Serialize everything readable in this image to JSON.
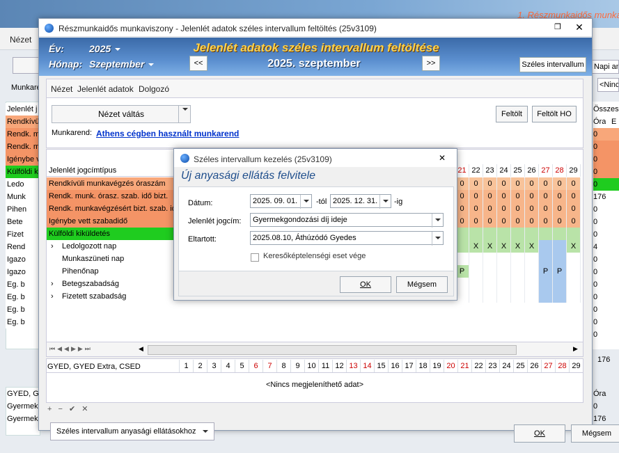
{
  "background": {
    "banner_title": "1. Részmunkaidős munkaviszony (Munkarend",
    "nezet": "Nézet",
    "munkarend": "Munkarend",
    "napi": "Napi ana",
    "nincs": "<Nincs",
    "left_rows": [
      "Jelenlét j",
      "Rendkívüli",
      "Rendk. m",
      "Rendk. m",
      "Igénybe v",
      "Külföldi k",
      "Ledo",
      "Munk",
      "Pihen",
      "Bete",
      "Fizet",
      "Rend",
      "Igazo",
      "Igazo",
      "Eg. b",
      "Eg. b",
      "Eg. b",
      "Eg. b"
    ],
    "right_header": "Összesít",
    "right_cols": [
      "Óra",
      "E"
    ],
    "right_values": [
      "0",
      "0",
      "0",
      "0",
      "0",
      "176",
      "0",
      "0",
      "0",
      "4",
      "0",
      "0",
      "0",
      "0",
      "0",
      "0",
      "0"
    ],
    "right_total": "176",
    "lower_rows": [
      "GYED, GY",
      "Gyermek",
      "Gyermek"
    ],
    "lower_right": [
      "Óra",
      "0",
      "176"
    ]
  },
  "window": {
    "title": "Részmunkaidős munkaviszony - Jelenlét adatok széles intervallum feltöltés (25v3109)",
    "ev_label": "Év:",
    "ev_value": "2025",
    "honap_label": "Hónap:",
    "honap_value": "Szeptember",
    "header_title": "Jelenlét adatok széles intervallum feltöltése",
    "header_date": "2025. szeptember",
    "prev": "<<",
    "next": ">>",
    "szeles_btn": "Széles intervallum",
    "menu": [
      "Nézet",
      "Jelenlét adatok",
      "Dolgozó"
    ],
    "nezet_valtas": "Nézet váltás",
    "feltolt": "Feltölt",
    "feltolt_ho": "Feltölt HO",
    "munkarend_label": "Munkarend:",
    "munkarend_link": "Athens cégben használt munkarend",
    "grid_header": "Jelenlét jogcímtípus",
    "grid_rows": [
      {
        "label": "Rendkívüli munkavégzés óraszám",
        "style": "orange",
        "indent": 0
      },
      {
        "label": "Rendk. munk. órasz. szab. idő bizt.",
        "style": "orange2",
        "indent": 0
      },
      {
        "label": "Rendk. munkavégzésért bizt. szab. idő",
        "style": "orange2",
        "indent": 0
      },
      {
        "label": "Igénybe vett szabadidő",
        "style": "orange2",
        "indent": 0
      },
      {
        "label": "Külföldi kiküldetés",
        "style": "green",
        "indent": 0
      },
      {
        "label": "Ledolgozott nap",
        "style": "",
        "indent": 1,
        "expand": ">"
      },
      {
        "label": "Munkaszüneti nap",
        "style": "",
        "indent": 1
      },
      {
        "label": "Pihenőnap",
        "style": "",
        "indent": 1
      },
      {
        "label": "Betegszabadság",
        "style": "",
        "indent": 1,
        "expand": ">"
      },
      {
        "label": "Fizetett szabadság",
        "style": "",
        "indent": 1,
        "expand": ">"
      }
    ],
    "day_headers": [
      "21",
      "22",
      "23",
      "24",
      "25",
      "26",
      "27",
      "28",
      "29"
    ],
    "day_values": [
      [
        "0",
        "0",
        "0",
        "0",
        "0",
        "0",
        "0",
        "0",
        "0"
      ],
      [
        "0",
        "0",
        "0",
        "0",
        "0",
        "0",
        "0",
        "0",
        "0"
      ],
      [
        "0",
        "0",
        "0",
        "0",
        "0",
        "0",
        "0",
        "0",
        "0"
      ],
      [
        "0",
        "0",
        "0",
        "0",
        "0",
        "0",
        "0",
        "0",
        "0"
      ],
      [
        "",
        "",
        "",
        "",
        "",
        "",
        "",
        "",
        ""
      ],
      [
        "",
        "X",
        "X",
        "X",
        "X",
        "X",
        "",
        "",
        "X"
      ],
      [
        "",
        "",
        "",
        "",
        "",
        "",
        "",
        "",
        ""
      ],
      [
        "P",
        "",
        "",
        "",
        "",
        "",
        "P",
        "P",
        ""
      ],
      [
        "",
        "",
        "",
        "",
        "",
        "",
        "",
        "",
        ""
      ],
      [
        "",
        "",
        "",
        "",
        "",
        "",
        "",
        "",
        ""
      ]
    ],
    "grid2_label": "GYED, GYED Extra, CSED",
    "grid2_days": [
      "1",
      "2",
      "3",
      "4",
      "5",
      "6",
      "7",
      "8",
      "9",
      "10",
      "11",
      "12",
      "13",
      "14",
      "15",
      "16",
      "17",
      "18",
      "19",
      "20",
      "21",
      "22",
      "23",
      "24",
      "25",
      "26",
      "27",
      "28",
      "29"
    ],
    "grid2_empty": "<Nincs megjeleníthető adat>",
    "bottom_dropdown": "Széles intervallum anyasági ellátásokhoz",
    "ok": "OK",
    "megsem": "Mégsem"
  },
  "dialog": {
    "title": "Széles intervallum kezelés (25v3109)",
    "heading": "Új anyasági ellátás felvitele",
    "datum_label": "Dátum:",
    "from_value": "2025. 09. 01.",
    "tol": "-tól",
    "to_value": "2025. 12. 31.",
    "ig": "-ig",
    "jogcim_label": "Jelenlét jogcím:",
    "jogcim_value": "Gyermekgondozási díj ideje",
    "eltartott_label": "Eltartott:",
    "eltartott_value": "2025.08.10, Áthúzódó Gyedes",
    "checkbox_label": "Keresőképtelenségi eset vége",
    "ok": "OK",
    "megsem": "Mégsem"
  },
  "colors": {
    "weekend_red": "#cc0000",
    "orange": "#f8a77a",
    "green": "#1fcc1f",
    "blue_cell": "#a9c9ee",
    "green_cell": "#b9e3a8"
  }
}
